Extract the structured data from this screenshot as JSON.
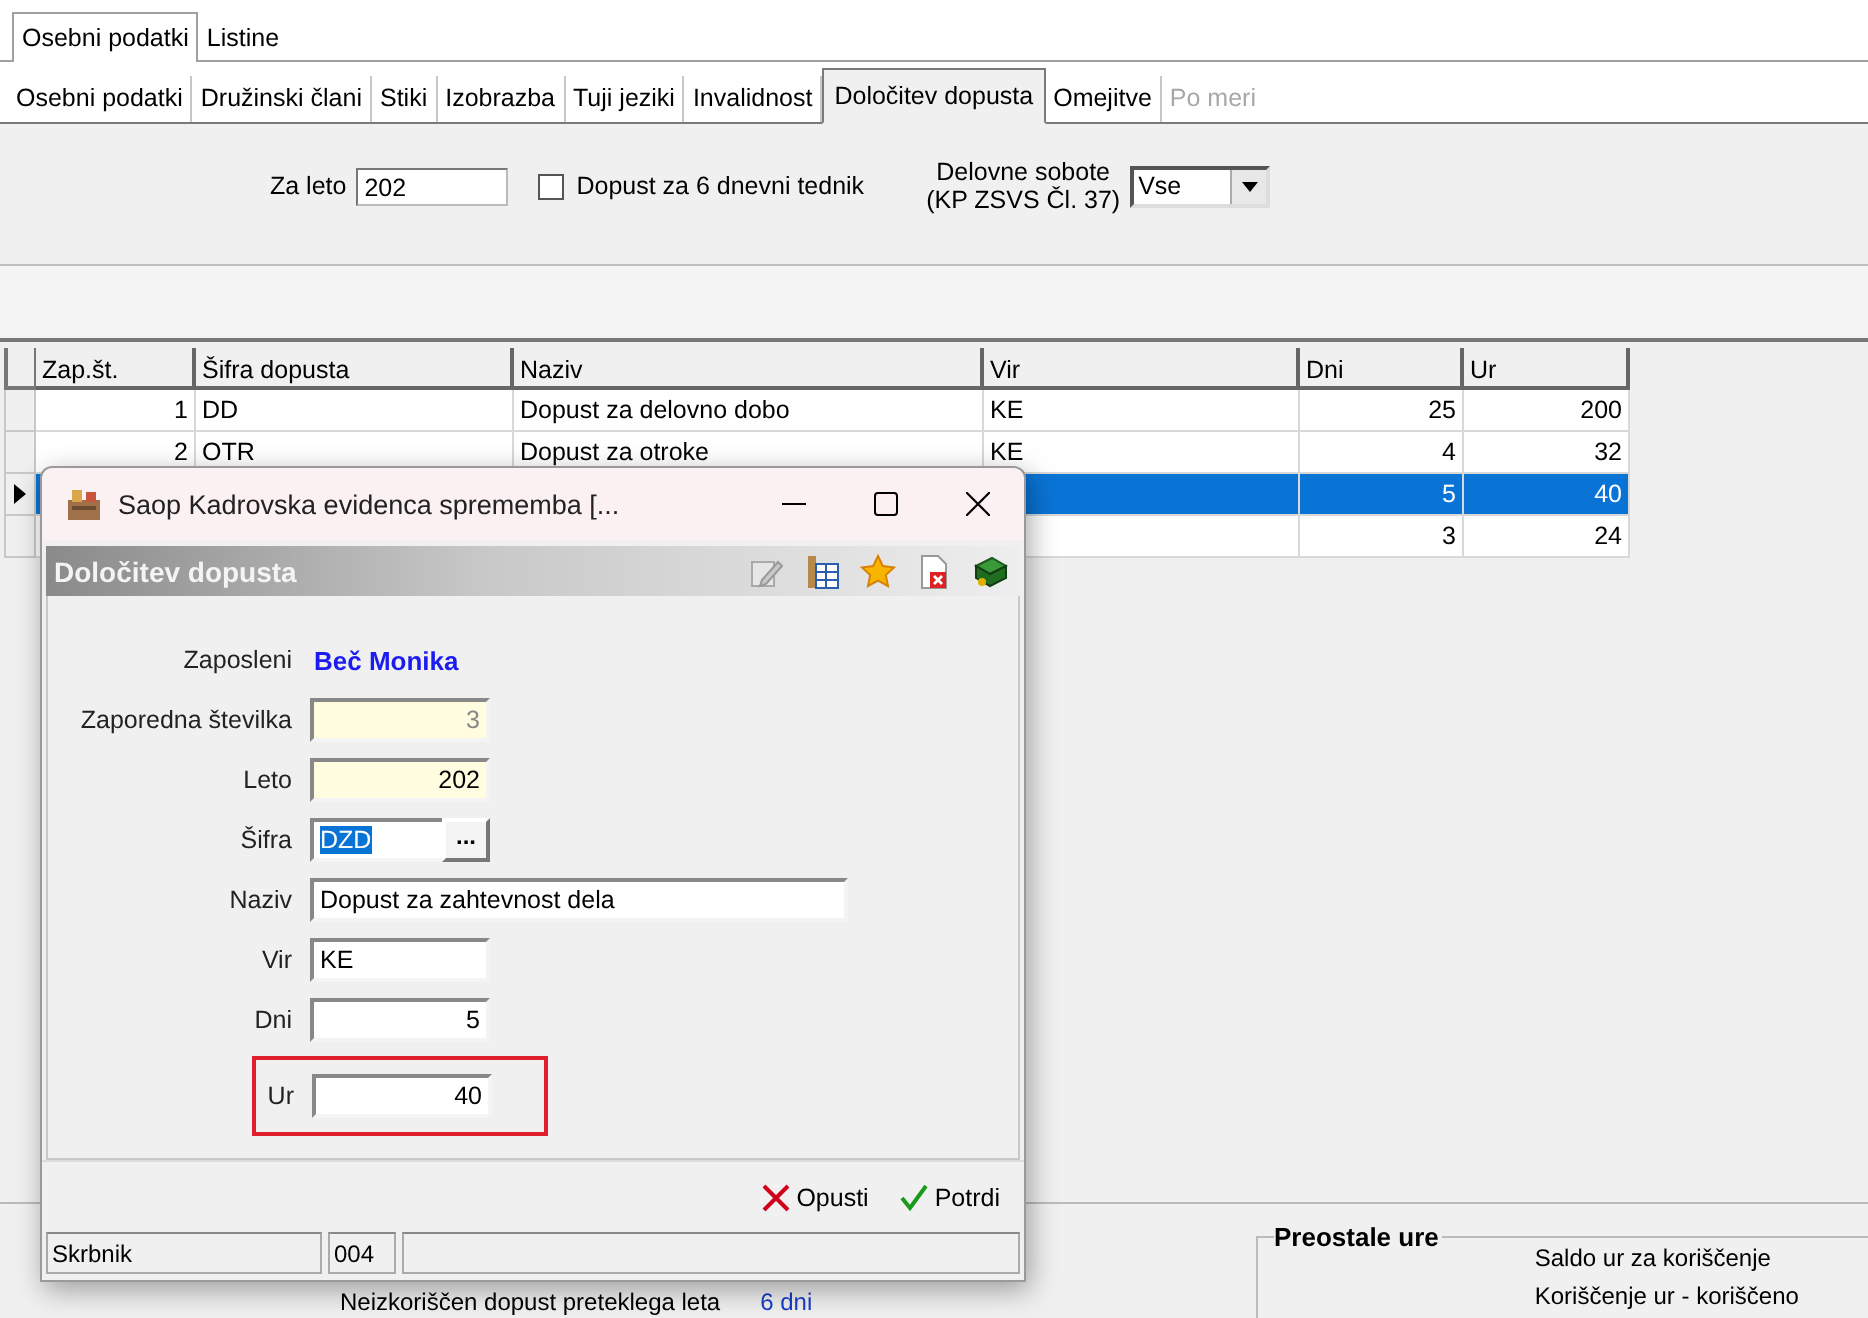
{
  "outer_tabs": [
    {
      "label": "Osebni podatki",
      "selected": true
    },
    {
      "label": "Listine",
      "selected": false
    }
  ],
  "tabs": [
    {
      "label": "Osebni podatki",
      "selected": false,
      "disabled": false
    },
    {
      "label": "Družinski člani",
      "selected": false,
      "disabled": false
    },
    {
      "label": "Stiki",
      "selected": false,
      "disabled": false
    },
    {
      "label": "Izobrazba",
      "selected": false,
      "disabled": false
    },
    {
      "label": "Tuji jeziki",
      "selected": false,
      "disabled": false
    },
    {
      "label": "Invalidnost",
      "selected": false,
      "disabled": false
    },
    {
      "label": "Določitev dopusta",
      "selected": true,
      "disabled": false
    },
    {
      "label": "Omejitve",
      "selected": false,
      "disabled": false
    },
    {
      "label": "Po meri",
      "selected": false,
      "disabled": true
    }
  ],
  "filter": {
    "year_label": "Za leto",
    "year_value": "202",
    "checkbox": {
      "label": "Dopust za 6 dnevni tednik",
      "checked": false
    },
    "saturdays_label": [
      "Delovne sobote",
      "(KP ZSVS Čl. 37)"
    ],
    "saturdays_value": "Vse"
  },
  "table": {
    "columns": [
      {
        "label": "Zap.št.",
        "kind": "number"
      },
      {
        "label": "Šifra dopusta",
        "kind": "text"
      },
      {
        "label": "Naziv",
        "kind": "text"
      },
      {
        "label": "Vir",
        "kind": "text"
      },
      {
        "label": "Dni",
        "kind": "number"
      },
      {
        "label": "Ur",
        "kind": "number"
      }
    ],
    "rows": [
      {
        "selected": false,
        "current": false,
        "cells": [
          "1",
          "DD",
          "Dopust za delovno dobo",
          "KE",
          "25",
          "200"
        ]
      },
      {
        "selected": false,
        "current": false,
        "cells": [
          "2",
          "OTR",
          "Dopust za otroke",
          "KE",
          "4",
          "32"
        ]
      },
      {
        "selected": true,
        "current": true,
        "cells": [
          null,
          null,
          null,
          null,
          "5",
          "40"
        ]
      },
      {
        "selected": false,
        "current": false,
        "cells": [
          null,
          null,
          null,
          null,
          "3",
          "24"
        ]
      }
    ]
  },
  "bottom_panel": {
    "unused_label": "Neizkoriščen dopust preteklega leta",
    "unused_value": "6 dni",
    "remaining": {
      "title": "Preostale ure",
      "lines": [
        "Saldo ur za koriščenje",
        "Koriščenje ur - koriščeno"
      ]
    }
  },
  "dialog": {
    "title": "Saop Kadrovska evidenca sprememba [...",
    "header": "Določitev dopusta",
    "fields": [
      {
        "kind": "display",
        "label": "Zaposleni",
        "value": "Beč Monika"
      },
      {
        "kind": "number",
        "label": "Zaporedna številka",
        "value": "3",
        "locked": true,
        "disabled": true
      },
      {
        "kind": "number",
        "label": "Leto",
        "value": "202",
        "locked": true,
        "disabled": false
      },
      {
        "kind": "lookup",
        "label": "Šifra",
        "value": "DZD",
        "button": "...",
        "text_selected": true
      },
      {
        "kind": "long_text",
        "label": "Naziv",
        "value": "Dopust za zahtevnost dela"
      },
      {
        "kind": "text",
        "label": "Vir",
        "value": "KE"
      },
      {
        "kind": "number",
        "label": "Dni",
        "value": "5",
        "locked": false,
        "disabled": false
      },
      {
        "kind": "number",
        "label": "Ur",
        "value": "40",
        "locked": false,
        "disabled": false,
        "highlighted": true
      }
    ],
    "buttons": [
      {
        "kind": "cancel",
        "label": "Opusti"
      },
      {
        "kind": "confirm",
        "label": "Potrdi"
      }
    ],
    "status_bar": {
      "user": "Skrbnik",
      "code": "004"
    }
  }
}
